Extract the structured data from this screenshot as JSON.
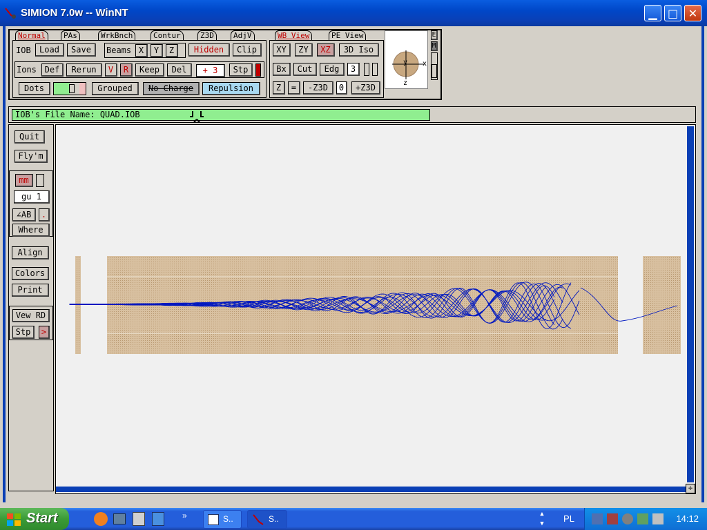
{
  "window": {
    "title": "SIMION 7.0w -- WinNT",
    "minimize": "▁",
    "maximize": "□",
    "close": "✕"
  },
  "tabs": [
    {
      "label": "Normal"
    },
    {
      "label": "PAs"
    },
    {
      "label": "WrkBnch"
    },
    {
      "label": "Contur"
    },
    {
      "label": "Z3D"
    },
    {
      "label": "AdjV"
    }
  ],
  "view_tabs": [
    {
      "label": "WB View"
    },
    {
      "label": "PE View"
    }
  ],
  "iob": {
    "label": "IOB",
    "load": "Load",
    "save": "Save"
  },
  "beams": {
    "label": "Beams",
    "x": "X",
    "y": "Y",
    "z": "Z",
    "hidden": "Hidden",
    "clip": "Clip"
  },
  "ions": {
    "label": "Ions",
    "def": "Def",
    "rerun": "Rerun",
    "v": "V",
    "r": "R",
    "keep": "Keep",
    "del": "Del",
    "count": "+ 3",
    "stp": "Stp"
  },
  "dots": {
    "label": "Dots",
    "grouped": "Grouped",
    "no_charge": "No Charge",
    "repulsion": "Repulsion"
  },
  "view": {
    "xy": "XY",
    "zy": "ZY",
    "xz": "XZ",
    "iso": "3D Iso",
    "bx": "Bx",
    "cut": "Cut",
    "edg": "Edg",
    "level": "3",
    "z": "Z",
    "eq": "=",
    "mz3d": "-Z3D",
    "zero": "0",
    "pz3d": "+Z3D"
  },
  "side_e": "E",
  "side_m": "M",
  "compass": {
    "y": "y",
    "x": "x",
    "z": "z"
  },
  "file": {
    "label": "IOB's File Name: QUAD.IOB"
  },
  "left": {
    "quit": "Quit",
    "flym": "Fly'm",
    "mm": "mm",
    "gu": "gu  1",
    "ab": "∠AB",
    "dot": ".",
    "where": "Where",
    "align": "Align",
    "colors": "Colors",
    "print": "Print",
    "vew_rd": "Vew RD",
    "stp": "Stp",
    "arrow": ">"
  },
  "taskbar": {
    "start": "Start",
    "item1": "S..",
    "item2": "S..",
    "lang": "PL",
    "clock": "14:12",
    "more": "»"
  },
  "colors": {
    "trajectory": "#0018c0",
    "electrode": "#c8a880",
    "accent_red": "#c00000",
    "field_green": "#90ee90"
  }
}
